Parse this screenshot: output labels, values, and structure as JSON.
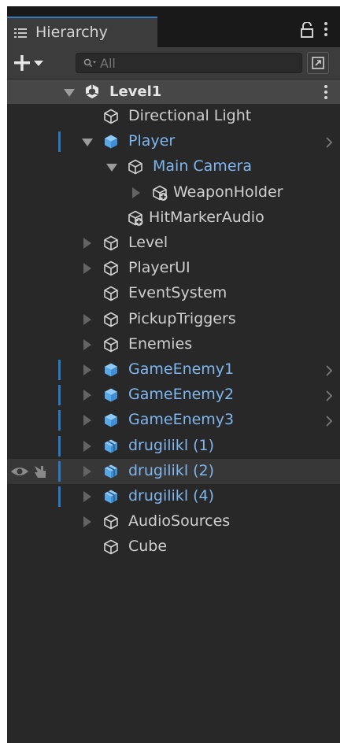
{
  "window": {
    "tab_title": "Hierarchy"
  },
  "search": {
    "placeholder": "All",
    "value": ""
  },
  "scene": {
    "name": "Level1"
  },
  "colors": {
    "panel": "#282828",
    "selected_text": "#7eb6ef",
    "prefab_icon": "#6fb7ef",
    "marker": "#2a78c2"
  },
  "items": [
    {
      "label": "Directional Light",
      "depth": 1,
      "expander": "none",
      "icon": "gameobject-cube-icon",
      "blue": false
    },
    {
      "label": "Player",
      "depth": 1,
      "expander": "expanded",
      "icon": "prefab-cube-icon",
      "blue": true,
      "marker": true,
      "chevron": true
    },
    {
      "label": "Main Camera",
      "depth": 2,
      "expander": "expanded",
      "icon": "gameobject-cube-icon",
      "blue": true
    },
    {
      "label": "WeaponHolder",
      "depth": 3,
      "expander": "collapsed",
      "icon": "added-gameobject-icon",
      "blue": false
    },
    {
      "label": "HitMarkerAudio",
      "depth": 2,
      "expander": "none",
      "icon": "added-gameobject-icon",
      "blue": false
    },
    {
      "label": "Level",
      "depth": 1,
      "expander": "collapsed",
      "icon": "gameobject-cube-icon",
      "blue": false
    },
    {
      "label": "PlayerUI",
      "depth": 1,
      "expander": "collapsed",
      "icon": "gameobject-cube-icon",
      "blue": false
    },
    {
      "label": "EventSystem",
      "depth": 1,
      "expander": "none",
      "icon": "gameobject-cube-icon",
      "blue": false
    },
    {
      "label": "PickupTriggers",
      "depth": 1,
      "expander": "collapsed",
      "icon": "gameobject-cube-icon",
      "blue": false
    },
    {
      "label": "Enemies",
      "depth": 1,
      "expander": "collapsed",
      "icon": "gameobject-cube-icon",
      "blue": false
    },
    {
      "label": "GameEnemy1",
      "depth": 1,
      "expander": "collapsed",
      "icon": "prefab-cube-icon",
      "blue": true,
      "marker": true,
      "chevron": true
    },
    {
      "label": "GameEnemy2",
      "depth": 1,
      "expander": "collapsed",
      "icon": "prefab-cube-icon",
      "blue": true,
      "marker": true,
      "chevron": true
    },
    {
      "label": "GameEnemy3",
      "depth": 1,
      "expander": "collapsed",
      "icon": "prefab-cube-icon",
      "blue": true,
      "marker": true,
      "chevron": true
    },
    {
      "label": "drugilikl (1)",
      "depth": 1,
      "expander": "collapsed",
      "icon": "model-prefab-icon",
      "blue": true,
      "marker": true
    },
    {
      "label": "drugilikl (2)",
      "depth": 1,
      "expander": "collapsed",
      "icon": "model-prefab-icon",
      "blue": true,
      "marker": true,
      "hovered": true
    },
    {
      "label": "drugilikl (4)",
      "depth": 1,
      "expander": "collapsed",
      "icon": "model-prefab-icon",
      "blue": true,
      "marker": true
    },
    {
      "label": "AudioSources",
      "depth": 1,
      "expander": "collapsed",
      "icon": "gameobject-cube-icon",
      "blue": false
    },
    {
      "label": "Cube",
      "depth": 1,
      "expander": "none",
      "icon": "gameobject-cube-icon",
      "blue": false
    }
  ]
}
